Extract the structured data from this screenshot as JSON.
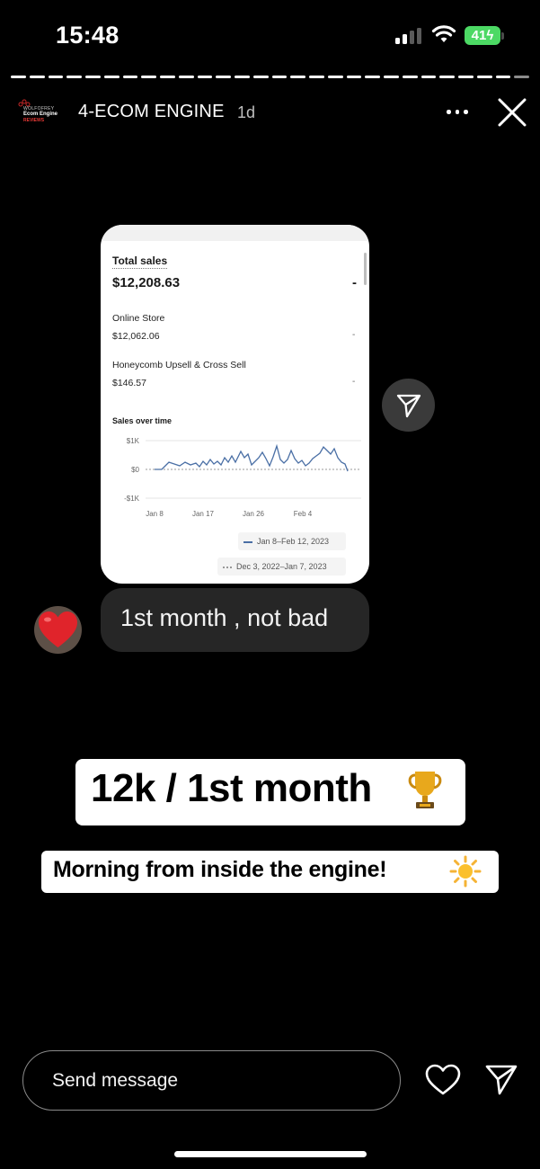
{
  "status_bar": {
    "time": "15:48",
    "battery": "41"
  },
  "header": {
    "account_name": "4-ECOM ENGINE",
    "age": "1d",
    "logo": {
      "line1": "WOLFOFREY",
      "line2": "Ecom Engine",
      "line3": "REVIEWS"
    }
  },
  "shared_post": {
    "total_sales_label": "Total sales",
    "total_sales_value": "$12,208.63",
    "total_sales_change": "-",
    "rows": [
      {
        "label": "Online Store",
        "value": "$12,062.06",
        "change": "-"
      },
      {
        "label": "Honeycomb Upsell & Cross Sell",
        "value": "$146.57",
        "change": "-"
      }
    ],
    "chart_title": "Sales over time",
    "y_ticks": [
      "$1K",
      "$0",
      "-$1K"
    ],
    "x_ticks": [
      "Jan 8",
      "Jan 17",
      "Jan 26",
      "Feb 4"
    ],
    "legend_current": "Jan 8–Feb 12, 2023",
    "legend_previous": "Dec 3, 2022–Jan 7, 2023",
    "accent_color": "#4a6fa5"
  },
  "reply": {
    "text": "1st month , not bad"
  },
  "stickers": {
    "headline": "12k / 1st month",
    "subline": "Morning from inside the engine!"
  },
  "message_bar": {
    "placeholder": "Send message"
  },
  "icons": [
    "ellipsis-icon",
    "close-icon",
    "send-icon",
    "heart-icon",
    "trophy-icon",
    "sun-icon"
  ]
}
